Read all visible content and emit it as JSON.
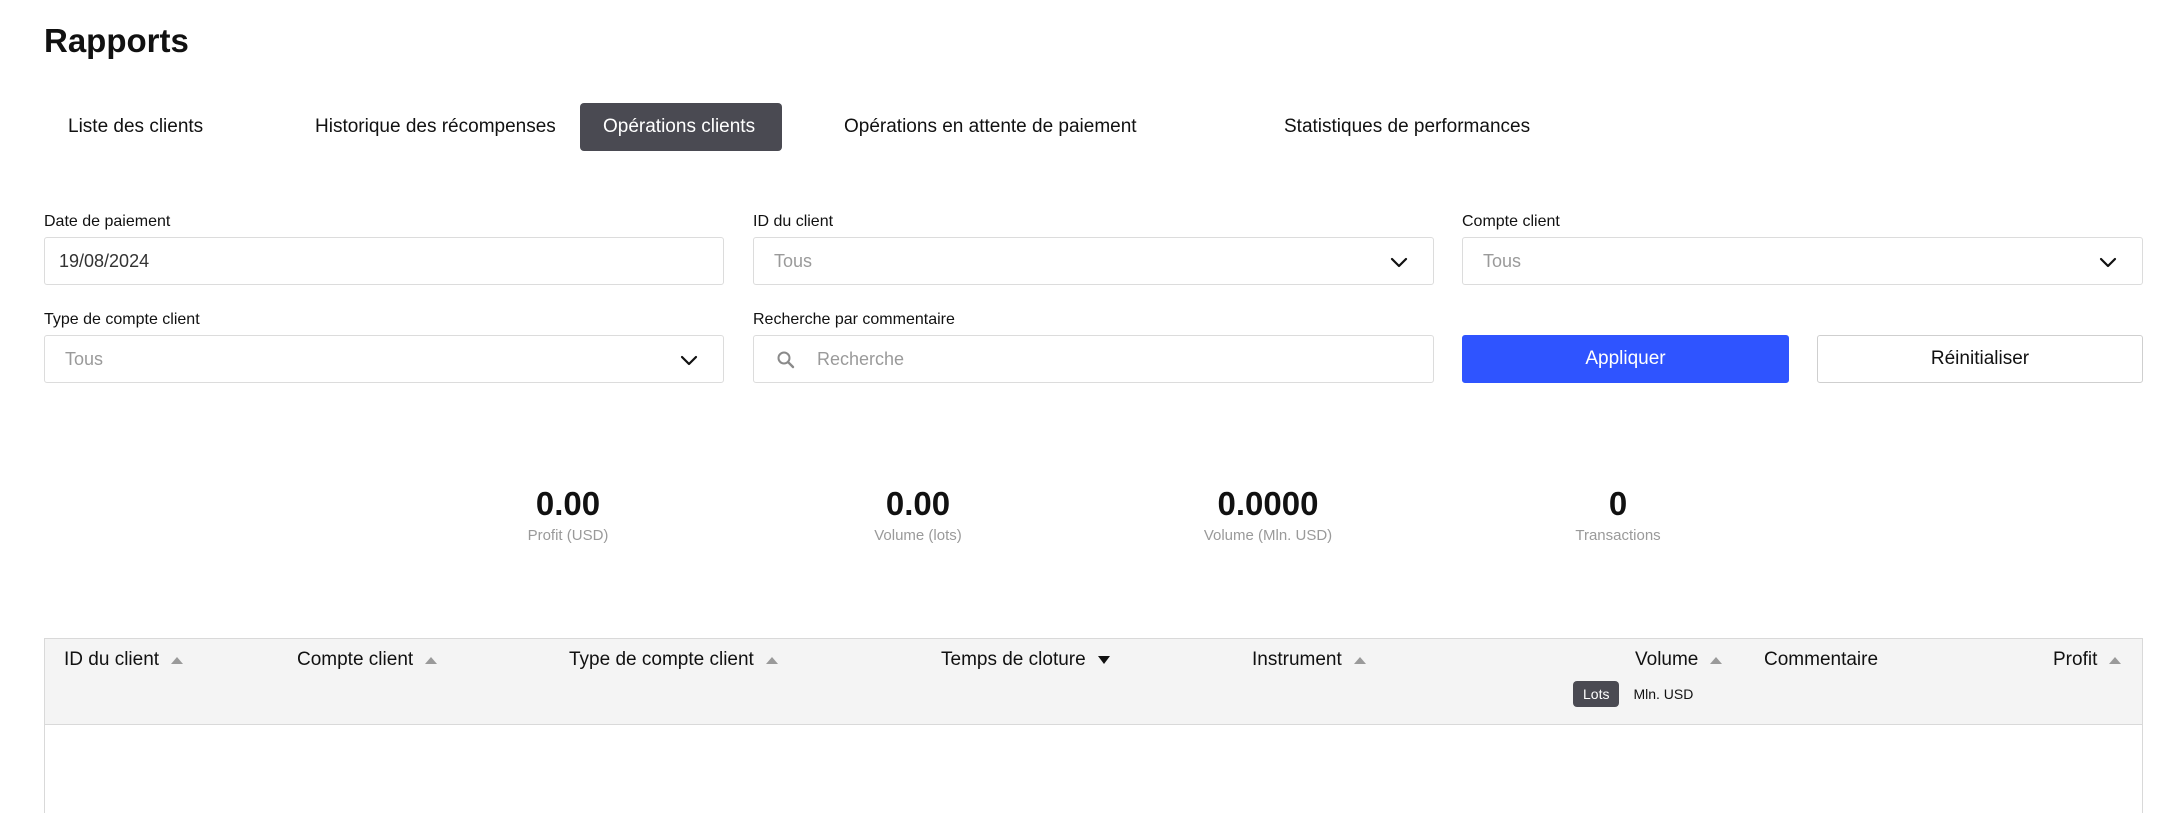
{
  "page": {
    "title": "Rapports"
  },
  "tabs": [
    {
      "label": "Liste des clients",
      "active": false
    },
    {
      "label": "Historique des récompenses",
      "active": false
    },
    {
      "label": "Opérations clients",
      "active": true
    },
    {
      "label": "Opérations en attente de paiement",
      "active": false
    },
    {
      "label": "Statistiques de performances",
      "active": false
    }
  ],
  "filters": {
    "payment_date": {
      "label": "Date de paiement",
      "value": "19/08/2024"
    },
    "client_id": {
      "label": "ID du client",
      "value": "Tous"
    },
    "client_account": {
      "label": "Compte client",
      "value": "Tous"
    },
    "account_type": {
      "label": "Type de compte client",
      "value": "Tous"
    },
    "comment_search": {
      "label": "Recherche par commentaire",
      "placeholder": "Recherche"
    },
    "apply_label": "Appliquer",
    "reset_label": "Réinitialiser"
  },
  "stats": [
    {
      "value": "0.00",
      "label": "Profit (USD)"
    },
    {
      "value": "0.00",
      "label": "Volume (lots)"
    },
    {
      "value": "0.0000",
      "label": "Volume (Mln. USD)"
    },
    {
      "value": "0",
      "label": "Transactions"
    }
  ],
  "table": {
    "columns": {
      "client_id": "ID du client",
      "client_account": "Compte client",
      "account_type": "Type de compte client",
      "close_time": "Temps de cloture",
      "instrument": "Instrument",
      "volume": "Volume",
      "comment": "Commentaire",
      "profit": "Profit"
    },
    "volume_units": {
      "lots": "Lots",
      "mln_usd": "Mln. USD",
      "selected": "Lots"
    },
    "rows": []
  },
  "colors": {
    "accent": "#2f54ff",
    "active_tab": "#4a4a52",
    "header_bg": "#f4f4f4"
  }
}
